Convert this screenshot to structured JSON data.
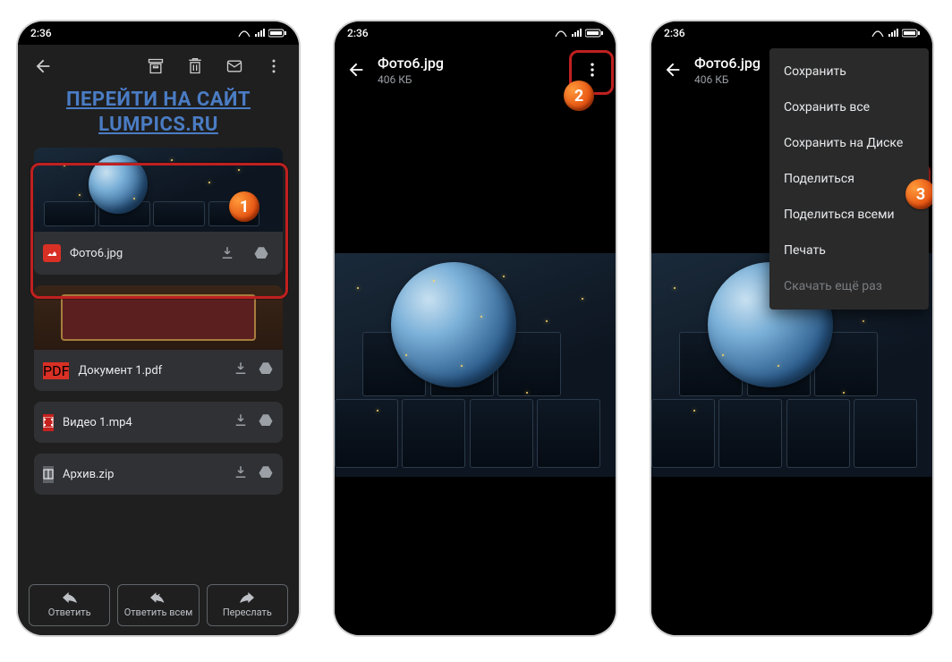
{
  "status": {
    "time": "2:36"
  },
  "phone1": {
    "linkLine1": "ПЕРЕЙТИ НА САЙТ",
    "linkLine2": "LUMPICS.RU",
    "attachments": [
      {
        "name": "Фото6.jpg",
        "type": "img"
      },
      {
        "name": "Документ 1.pdf",
        "type": "pdf"
      },
      {
        "name": "Видео 1.mp4",
        "type": "vid"
      },
      {
        "name": "Архив.zip",
        "type": "zip"
      }
    ],
    "reply": "Ответить",
    "replyAll": "Ответить всем",
    "forward": "Переслать"
  },
  "viewer": {
    "filename": "Фото6.jpg",
    "size": "406 КБ"
  },
  "menu": {
    "items": [
      "Сохранить",
      "Сохранить все",
      "Сохранить на Диске",
      "Поделиться",
      "Поделиться всеми",
      "Печать",
      "Скачать ещё раз"
    ]
  },
  "badges": {
    "b1": "1",
    "b2": "2",
    "b3": "3"
  }
}
